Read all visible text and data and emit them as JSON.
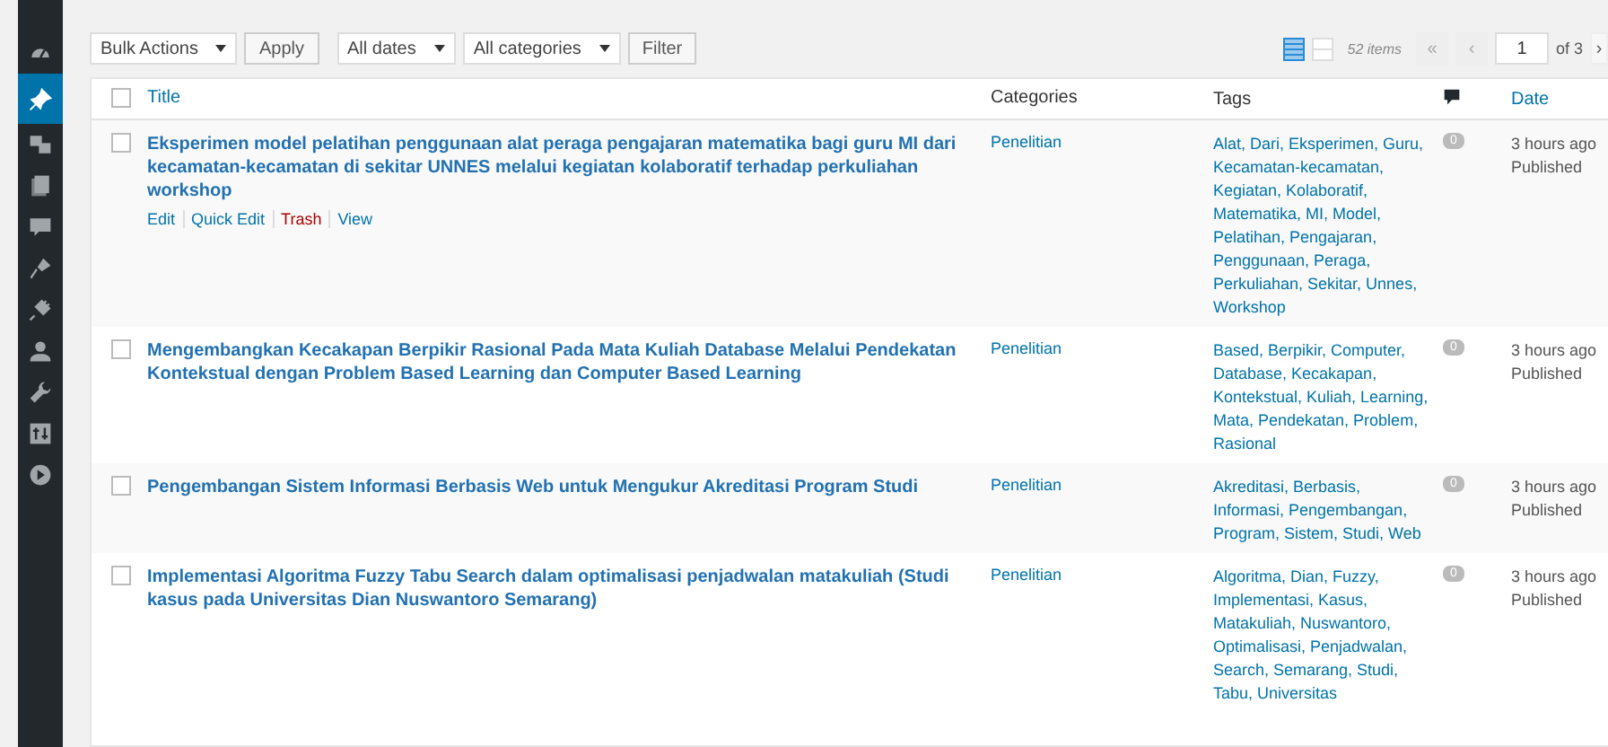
{
  "sidebar": {
    "items": [
      {
        "selected": false
      },
      {
        "selected": true
      },
      {
        "selected": false
      },
      {
        "selected": false
      },
      {
        "selected": false
      },
      {
        "selected": false
      },
      {
        "selected": false
      },
      {
        "selected": false
      },
      {
        "selected": false
      },
      {
        "selected": false
      },
      {
        "selected": false
      }
    ]
  },
  "toolbar": {
    "bulk_actions": "Bulk Actions",
    "apply": "Apply",
    "dates": "All dates",
    "categories": "All categories",
    "filter": "Filter",
    "view_modes": [
      {
        "selected": true
      },
      {
        "selected": false
      }
    ],
    "items_count": "52 items",
    "first": "«",
    "prev": "‹",
    "page": "1",
    "of_pages": "of 3",
    "next": "›"
  },
  "table": {
    "columns": {
      "title": "Title",
      "categories": "Categories",
      "tags": "Tags",
      "date": "Date"
    },
    "select_all_checked": false,
    "rows": [
      {
        "checked": false,
        "title": "Eksperimen model pelatihan penggunaan alat peraga pengajaran matematika bagi guru MI dari kecamatan-kecamatan di sekitar UNNES melalui kegiatan kolaboratif terhadap perkuliahan workshop",
        "actions": [
          {
            "label": "Edit",
            "kind": "normal"
          },
          {
            "label": "Quick Edit",
            "kind": "normal"
          },
          {
            "label": "Trash",
            "kind": "danger"
          },
          {
            "label": "View",
            "kind": "normal"
          }
        ],
        "category": "Penelitian",
        "tags": "Alat, Dari, Eksperimen, Guru, Kecamatan-kecamatan, Kegiatan, Kolaboratif, Matematika, MI, Model, Pelatihan, Pengajaran, Penggunaan, Peraga, Perkuliahan, Sekitar, Unnes, Workshop",
        "comments": "0",
        "date": "3 hours ago",
        "status": "Published"
      },
      {
        "checked": false,
        "title": "Mengembangkan Kecakapan Berpikir Rasional Pada Mata Kuliah Database Melalui Pendekatan Kontekstual dengan Problem Based Learning dan Computer Based Learning",
        "category": "Penelitian",
        "tags": "Based, Berpikir, Computer, Database, Kecakapan, Kontekstual, Kuliah, Learning, Mata, Pendekatan, Problem, Rasional",
        "comments": "0",
        "date": "3 hours ago",
        "status": "Published"
      },
      {
        "checked": false,
        "title": "Pengembangan Sistem Informasi Berbasis Web untuk Mengukur Akreditasi Program Studi",
        "category": "Penelitian",
        "tags": "Akreditasi, Berbasis, Informasi, Pengembangan, Program, Sistem, Studi, Web",
        "comments": "0",
        "date": "3 hours ago",
        "status": "Published"
      },
      {
        "checked": false,
        "title": "Implementasi Algoritma Fuzzy Tabu Search dalam optimalisasi penjadwalan matakuliah (Studi kasus pada Universitas Dian Nuswantoro Semarang)",
        "category": "Penelitian",
        "tags": "Algoritma, Dian, Fuzzy, Implementasi, Kasus, Matakuliah, Nuswantoro, Optimalisasi, Penjadwalan, Search, Semarang, Studi, Tabu, Universitas",
        "comments": "0",
        "date": "3 hours ago",
        "status": "Published"
      }
    ]
  }
}
